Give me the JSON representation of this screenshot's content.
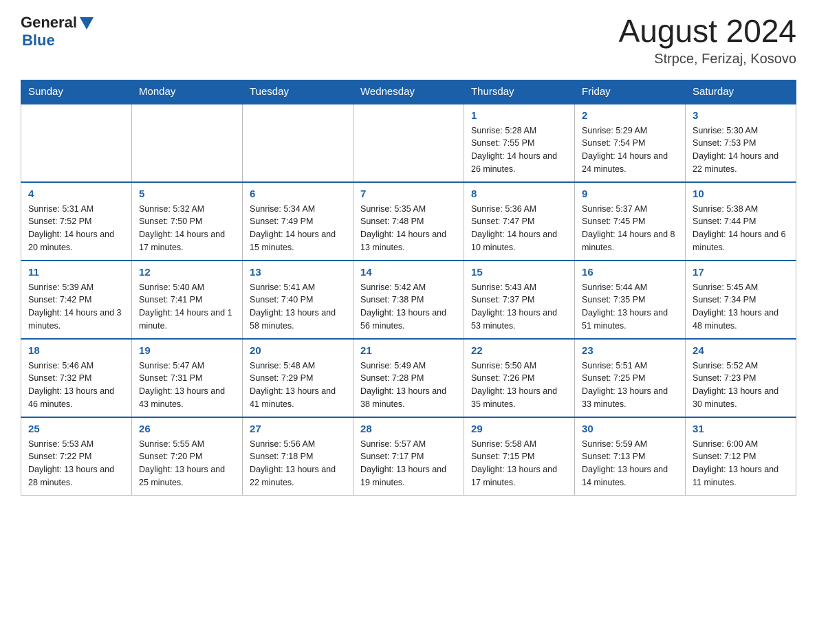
{
  "header": {
    "logo_text1": "General",
    "logo_text2": "Blue",
    "month": "August 2024",
    "location": "Strpce, Ferizaj, Kosovo"
  },
  "days_of_week": [
    "Sunday",
    "Monday",
    "Tuesday",
    "Wednesday",
    "Thursday",
    "Friday",
    "Saturday"
  ],
  "weeks": [
    [
      {
        "day": "",
        "info": ""
      },
      {
        "day": "",
        "info": ""
      },
      {
        "day": "",
        "info": ""
      },
      {
        "day": "",
        "info": ""
      },
      {
        "day": "1",
        "info": "Sunrise: 5:28 AM\nSunset: 7:55 PM\nDaylight: 14 hours and 26 minutes."
      },
      {
        "day": "2",
        "info": "Sunrise: 5:29 AM\nSunset: 7:54 PM\nDaylight: 14 hours and 24 minutes."
      },
      {
        "day": "3",
        "info": "Sunrise: 5:30 AM\nSunset: 7:53 PM\nDaylight: 14 hours and 22 minutes."
      }
    ],
    [
      {
        "day": "4",
        "info": "Sunrise: 5:31 AM\nSunset: 7:52 PM\nDaylight: 14 hours and 20 minutes."
      },
      {
        "day": "5",
        "info": "Sunrise: 5:32 AM\nSunset: 7:50 PM\nDaylight: 14 hours and 17 minutes."
      },
      {
        "day": "6",
        "info": "Sunrise: 5:34 AM\nSunset: 7:49 PM\nDaylight: 14 hours and 15 minutes."
      },
      {
        "day": "7",
        "info": "Sunrise: 5:35 AM\nSunset: 7:48 PM\nDaylight: 14 hours and 13 minutes."
      },
      {
        "day": "8",
        "info": "Sunrise: 5:36 AM\nSunset: 7:47 PM\nDaylight: 14 hours and 10 minutes."
      },
      {
        "day": "9",
        "info": "Sunrise: 5:37 AM\nSunset: 7:45 PM\nDaylight: 14 hours and 8 minutes."
      },
      {
        "day": "10",
        "info": "Sunrise: 5:38 AM\nSunset: 7:44 PM\nDaylight: 14 hours and 6 minutes."
      }
    ],
    [
      {
        "day": "11",
        "info": "Sunrise: 5:39 AM\nSunset: 7:42 PM\nDaylight: 14 hours and 3 minutes."
      },
      {
        "day": "12",
        "info": "Sunrise: 5:40 AM\nSunset: 7:41 PM\nDaylight: 14 hours and 1 minute."
      },
      {
        "day": "13",
        "info": "Sunrise: 5:41 AM\nSunset: 7:40 PM\nDaylight: 13 hours and 58 minutes."
      },
      {
        "day": "14",
        "info": "Sunrise: 5:42 AM\nSunset: 7:38 PM\nDaylight: 13 hours and 56 minutes."
      },
      {
        "day": "15",
        "info": "Sunrise: 5:43 AM\nSunset: 7:37 PM\nDaylight: 13 hours and 53 minutes."
      },
      {
        "day": "16",
        "info": "Sunrise: 5:44 AM\nSunset: 7:35 PM\nDaylight: 13 hours and 51 minutes."
      },
      {
        "day": "17",
        "info": "Sunrise: 5:45 AM\nSunset: 7:34 PM\nDaylight: 13 hours and 48 minutes."
      }
    ],
    [
      {
        "day": "18",
        "info": "Sunrise: 5:46 AM\nSunset: 7:32 PM\nDaylight: 13 hours and 46 minutes."
      },
      {
        "day": "19",
        "info": "Sunrise: 5:47 AM\nSunset: 7:31 PM\nDaylight: 13 hours and 43 minutes."
      },
      {
        "day": "20",
        "info": "Sunrise: 5:48 AM\nSunset: 7:29 PM\nDaylight: 13 hours and 41 minutes."
      },
      {
        "day": "21",
        "info": "Sunrise: 5:49 AM\nSunset: 7:28 PM\nDaylight: 13 hours and 38 minutes."
      },
      {
        "day": "22",
        "info": "Sunrise: 5:50 AM\nSunset: 7:26 PM\nDaylight: 13 hours and 35 minutes."
      },
      {
        "day": "23",
        "info": "Sunrise: 5:51 AM\nSunset: 7:25 PM\nDaylight: 13 hours and 33 minutes."
      },
      {
        "day": "24",
        "info": "Sunrise: 5:52 AM\nSunset: 7:23 PM\nDaylight: 13 hours and 30 minutes."
      }
    ],
    [
      {
        "day": "25",
        "info": "Sunrise: 5:53 AM\nSunset: 7:22 PM\nDaylight: 13 hours and 28 minutes."
      },
      {
        "day": "26",
        "info": "Sunrise: 5:55 AM\nSunset: 7:20 PM\nDaylight: 13 hours and 25 minutes."
      },
      {
        "day": "27",
        "info": "Sunrise: 5:56 AM\nSunset: 7:18 PM\nDaylight: 13 hours and 22 minutes."
      },
      {
        "day": "28",
        "info": "Sunrise: 5:57 AM\nSunset: 7:17 PM\nDaylight: 13 hours and 19 minutes."
      },
      {
        "day": "29",
        "info": "Sunrise: 5:58 AM\nSunset: 7:15 PM\nDaylight: 13 hours and 17 minutes."
      },
      {
        "day": "30",
        "info": "Sunrise: 5:59 AM\nSunset: 7:13 PM\nDaylight: 13 hours and 14 minutes."
      },
      {
        "day": "31",
        "info": "Sunrise: 6:00 AM\nSunset: 7:12 PM\nDaylight: 13 hours and 11 minutes."
      }
    ]
  ]
}
